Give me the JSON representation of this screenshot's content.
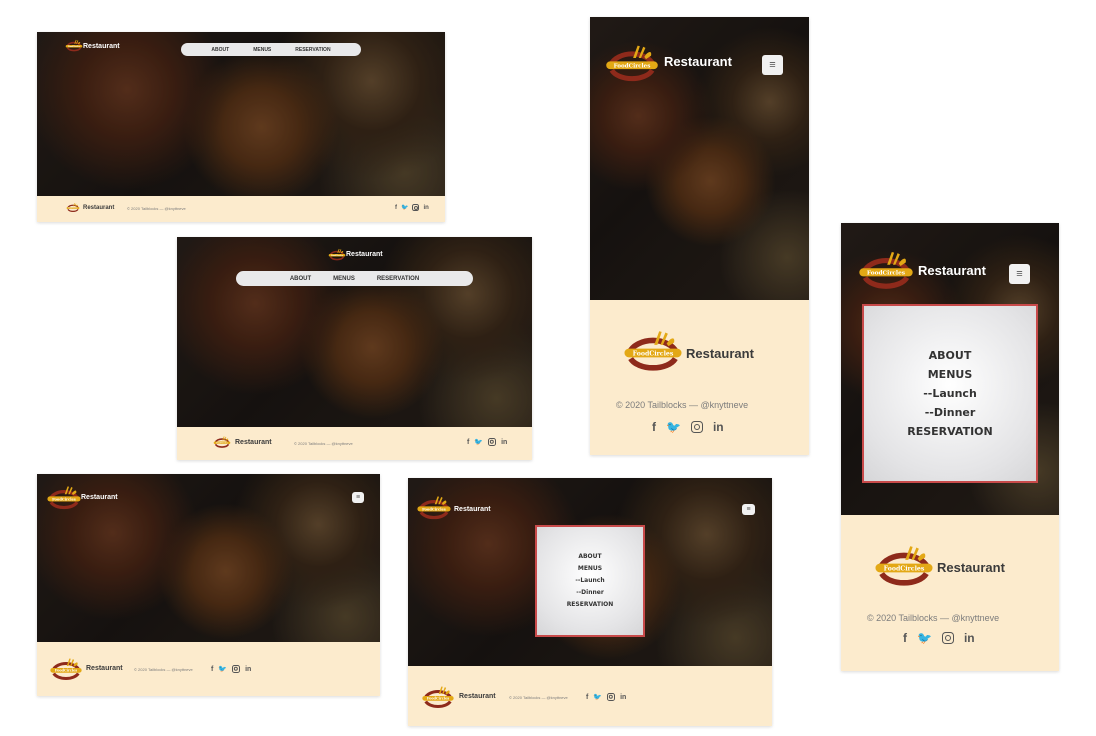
{
  "brand": {
    "name": "Restaurant",
    "logo_text": "FoodCircles"
  },
  "nav": {
    "about": "ABOUT",
    "menus": "MENUS",
    "reservation": "RESERVATION"
  },
  "dropdown": {
    "about": "ABOUT",
    "menus": "MENUS",
    "launch": "--Launch",
    "dinner": "--Dinner",
    "reservation": "RESERVATION"
  },
  "footer": {
    "copyright": "© 2020 Tailblocks — @knyttneve"
  },
  "social": {
    "facebook": "f",
    "twitter": "🐦",
    "linkedin": "in"
  },
  "icons": [
    "logo-icon",
    "menu-icon",
    "facebook-icon",
    "twitter-icon",
    "instagram-icon",
    "linkedin-icon"
  ],
  "colors": {
    "footer_bg": "#fcebcd",
    "logo_gold": "#e3a815",
    "logo_red": "#9c2a1a",
    "menu_border": "#c84a4a"
  }
}
